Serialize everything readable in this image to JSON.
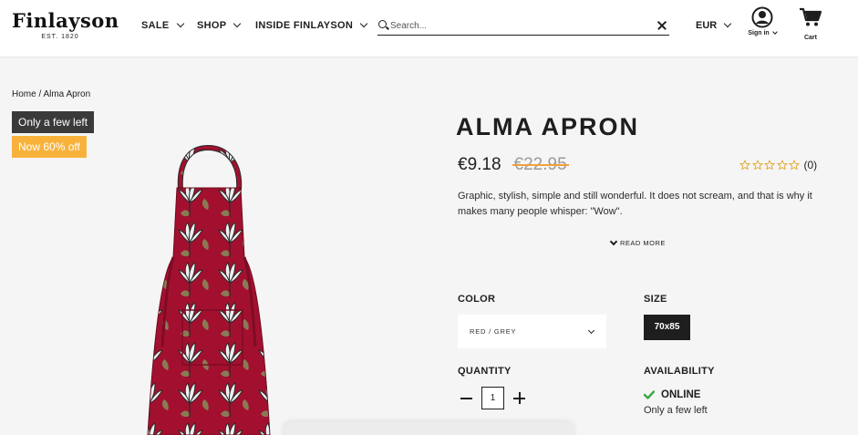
{
  "header": {
    "logo": {
      "name": "Finlayson",
      "established": "EST. 1820"
    },
    "nav": [
      {
        "label": "SALE"
      },
      {
        "label": "SHOP"
      },
      {
        "label": "INSIDE FINLAYSON"
      }
    ],
    "search": {
      "placeholder": "Search..."
    },
    "currency": "EUR",
    "account_label": "Sign in",
    "cart_label": "Cart"
  },
  "breadcrumb": "Home / Alma Apron",
  "badges": {
    "stock": "Only a few left",
    "discount": "Now 60% off"
  },
  "product": {
    "title": "ALMA APRON",
    "price_current": "€9.18",
    "price_original": "€22.95",
    "rating": {
      "stars": 0,
      "max": 5,
      "count": "(0)"
    },
    "description": "Graphic, stylish, simple and still wonderful. It does not scream, and that is why it makes many people whisper: \"Wow\".",
    "read_more": "READ MORE"
  },
  "options": {
    "color_label": "COLOR",
    "color_value": "RED / GREY",
    "size_label": "SIZE",
    "size_value": "70x85",
    "quantity_label": "QUANTITY",
    "quantity": "1",
    "availability_label": "AVAILABILITY",
    "availability_status": "ONLINE",
    "availability_note": "Only a few left"
  },
  "colors": {
    "badge_dark": "#3a3a3a",
    "badge_orange": "#f8b23c",
    "apron_red": "#a3102f",
    "check_green": "#3aa847",
    "star_gold": "#e2a52b"
  }
}
